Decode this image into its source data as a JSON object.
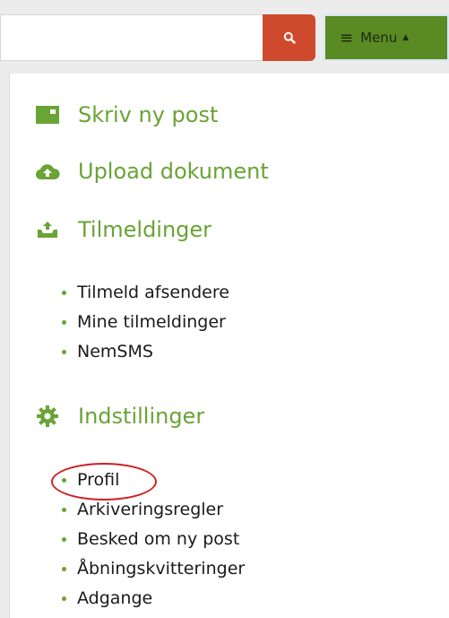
{
  "topbar": {
    "search": {
      "value": "",
      "placeholder": ""
    },
    "menu_label": "Menu"
  },
  "menu": {
    "sections": [
      {
        "label": "Skriv ny post"
      },
      {
        "label": "Upload dokument"
      },
      {
        "label": "Tilmeldinger",
        "items": [
          "Tilmeld afsendere",
          "Mine tilmeldinger",
          "NemSMS"
        ]
      },
      {
        "label": "Indstillinger",
        "items": [
          "Profil",
          "Arkiveringsregler",
          "Besked om ny post",
          "Åbningskvitteringer",
          "Adgange"
        ]
      }
    ]
  },
  "colors": {
    "accent": "#6aa336",
    "search_button": "#cf4a2c",
    "menu_button": "#5a8a23",
    "highlight": "#d21d24"
  }
}
